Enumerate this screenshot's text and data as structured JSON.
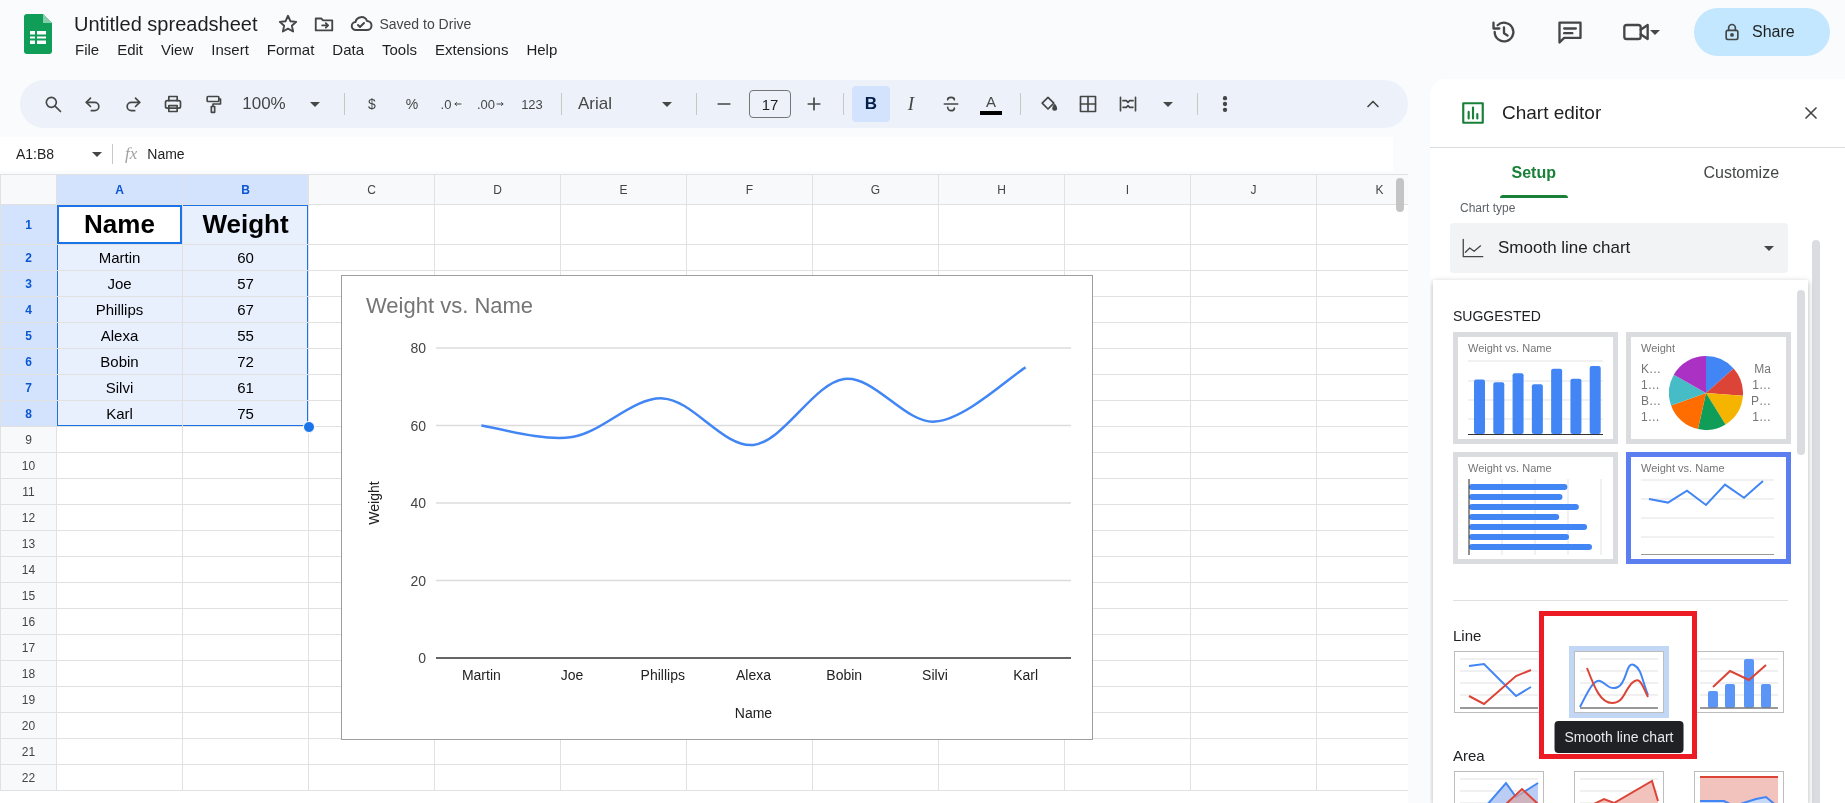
{
  "doc": {
    "title": "Untitled spreadsheet",
    "status": "Saved to Drive"
  },
  "menu": [
    "File",
    "Edit",
    "View",
    "Insert",
    "Format",
    "Data",
    "Tools",
    "Extensions",
    "Help"
  ],
  "share": {
    "label": "Share"
  },
  "toolbar": {
    "zoom": "100%",
    "currency": "$",
    "percent": "%",
    "decrease_decimal": ".0",
    "increase_decimal": ".00",
    "number_format": "123",
    "font": "Arial",
    "font_size": "17",
    "bold": {
      "label": "B",
      "on": true
    },
    "italic": {
      "label": "I",
      "on": false
    },
    "text_color": "A"
  },
  "formula_bar": {
    "cell_range": "A1:B8",
    "fx": "fx",
    "content": "Name"
  },
  "sheet": {
    "columns": [
      {
        "label": "A",
        "selected": true
      },
      {
        "label": "B",
        "selected": true
      },
      {
        "label": "C",
        "selected": false
      },
      {
        "label": "D",
        "selected": false
      },
      {
        "label": "E",
        "selected": false
      },
      {
        "label": "F",
        "selected": false
      },
      {
        "label": "G",
        "selected": false
      },
      {
        "label": "H",
        "selected": false
      },
      {
        "label": "I",
        "selected": false
      },
      {
        "label": "J",
        "selected": false
      },
      {
        "label": "K",
        "selected": false
      }
    ],
    "rows": [
      {
        "label": "1",
        "selected": true,
        "kind": "header",
        "cells": [
          {
            "text": "Name",
            "active": true
          },
          {
            "text": "Weight",
            "active": false
          }
        ]
      },
      {
        "label": "2",
        "selected": true,
        "kind": "data",
        "cells": [
          {
            "text": "Martin",
            "active": false
          },
          {
            "text": "60",
            "active": false
          }
        ]
      },
      {
        "label": "3",
        "selected": true,
        "kind": "data",
        "cells": [
          {
            "text": "Joe",
            "active": false
          },
          {
            "text": "57",
            "active": false
          }
        ]
      },
      {
        "label": "4",
        "selected": true,
        "kind": "data",
        "cells": [
          {
            "text": "Phillips",
            "active": false
          },
          {
            "text": "67",
            "active": false
          }
        ]
      },
      {
        "label": "5",
        "selected": true,
        "kind": "data",
        "cells": [
          {
            "text": "Alexa",
            "active": false
          },
          {
            "text": "55",
            "active": false
          }
        ]
      },
      {
        "label": "6",
        "selected": true,
        "kind": "data",
        "cells": [
          {
            "text": "Bobin",
            "active": false
          },
          {
            "text": "72",
            "active": false
          }
        ]
      },
      {
        "label": "7",
        "selected": true,
        "kind": "data",
        "cells": [
          {
            "text": "Silvi",
            "active": false
          },
          {
            "text": "61",
            "active": false
          }
        ]
      },
      {
        "label": "8",
        "selected": true,
        "kind": "data",
        "cells": [
          {
            "text": "Karl",
            "active": false
          },
          {
            "text": "75",
            "active": false
          }
        ]
      },
      {
        "label": "9",
        "selected": false,
        "kind": "empty"
      },
      {
        "label": "10",
        "selected": false,
        "kind": "empty"
      },
      {
        "label": "11",
        "selected": false,
        "kind": "empty"
      },
      {
        "label": "12",
        "selected": false,
        "kind": "empty"
      },
      {
        "label": "13",
        "selected": false,
        "kind": "empty"
      },
      {
        "label": "14",
        "selected": false,
        "kind": "empty"
      },
      {
        "label": "15",
        "selected": false,
        "kind": "empty"
      },
      {
        "label": "16",
        "selected": false,
        "kind": "empty"
      },
      {
        "label": "17",
        "selected": false,
        "kind": "empty"
      },
      {
        "label": "18",
        "selected": false,
        "kind": "empty"
      },
      {
        "label": "19",
        "selected": false,
        "kind": "empty"
      },
      {
        "label": "20",
        "selected": false,
        "kind": "empty"
      },
      {
        "label": "21",
        "selected": false,
        "kind": "empty"
      },
      {
        "label": "22",
        "selected": false,
        "kind": "empty"
      }
    ]
  },
  "chart": {
    "chart_data": {
      "type": "line",
      "title": "Weight vs. Name",
      "xlabel": "Name",
      "ylabel": "Weight",
      "categories": [
        "Martin",
        "Joe",
        "Phillips",
        "Alexa",
        "Bobin",
        "Silvi",
        "Karl"
      ],
      "series": [
        {
          "color": "#4285f4",
          "values": [
            60,
            57,
            67,
            55,
            72,
            61,
            75
          ]
        }
      ],
      "grid": true,
      "ylim": [
        0,
        80
      ],
      "yticks": [
        0,
        20,
        40,
        60,
        80
      ]
    }
  },
  "editor": {
    "title": "Chart editor",
    "tabs": [
      {
        "label": "Setup",
        "selected": true
      },
      {
        "label": "Customize",
        "selected": false
      }
    ],
    "chart_type_label": "Chart type",
    "chart_type": "Smooth line chart",
    "suggested_heading": "SUGGESTED",
    "suggested": [
      {
        "kind": "column",
        "title": "Weight vs. Name",
        "selected": false
      },
      {
        "kind": "pie",
        "title": "Weight",
        "left_labels": [
          "K…",
          "1…",
          "B…",
          "1…"
        ],
        "right_labels": [
          "Ma",
          "1…",
          "P…",
          "1…"
        ],
        "selected": false
      },
      {
        "kind": "bar",
        "title": "Weight vs. Name",
        "selected": false
      },
      {
        "kind": "line",
        "title": "Weight vs. Name",
        "selected": true
      }
    ],
    "groups": [
      {
        "heading": "Line",
        "options": [
          {
            "kind": "line",
            "selected": false
          },
          {
            "kind": "smooth",
            "selected": true,
            "tooltip": "Smooth line chart"
          },
          {
            "kind": "combo",
            "selected": false
          }
        ]
      },
      {
        "heading": "Area",
        "options": [
          {
            "kind": "area",
            "selected": false
          },
          {
            "kind": "stacked_area",
            "selected": false
          },
          {
            "kind": "full_area",
            "selected": false
          }
        ]
      }
    ]
  },
  "annotation_frame": true
}
